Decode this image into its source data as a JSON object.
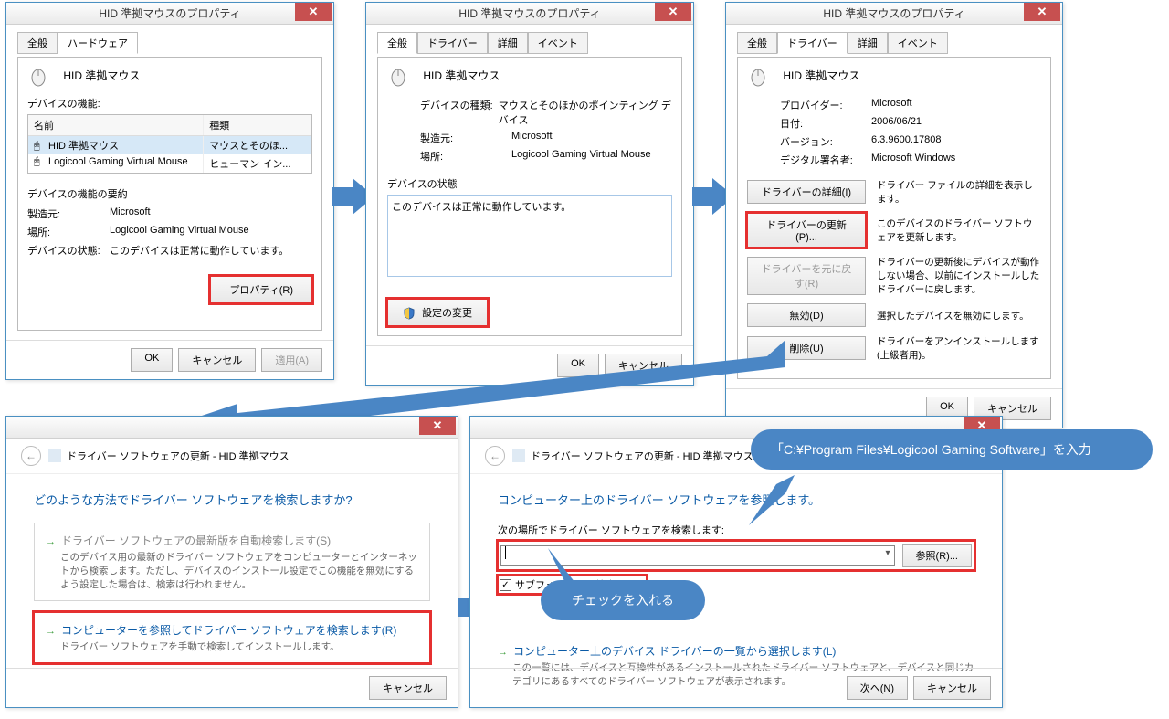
{
  "win1": {
    "title": "HID 準拠マウスのプロパティ",
    "tabs": [
      "全般",
      "ハードウェア"
    ],
    "device_name": "HID 準拠マウス",
    "func_label": "デバイスの機能:",
    "col_name": "名前",
    "col_type": "種類",
    "rows": [
      {
        "name": "HID 準拠マウス",
        "type": "マウスとそのほ..."
      },
      {
        "name": "Logicool Gaming Virtual Mouse",
        "type": "ヒューマン イン..."
      }
    ],
    "summary_label": "デバイスの機能の要約",
    "mfr_label": "製造元:",
    "mfr_val": "Microsoft",
    "loc_label": "場所:",
    "loc_val": "Logicool Gaming Virtual Mouse",
    "status_label": "デバイスの状態:",
    "status_val": "このデバイスは正常に動作しています。",
    "prop_btn": "プロパティ(R)",
    "ok": "OK",
    "cancel": "キャンセル",
    "apply": "適用(A)"
  },
  "win2": {
    "title": "HID 準拠マウスのプロパティ",
    "tabs": [
      "全般",
      "ドライバー",
      "詳細",
      "イベント"
    ],
    "device_name": "HID 準拠マウス",
    "type_label": "デバイスの種類:",
    "type_val": "マウスとそのほかのポインティング デバイス",
    "mfr_label": "製造元:",
    "mfr_val": "Microsoft",
    "loc_label": "場所:",
    "loc_val": "Logicool Gaming Virtual Mouse",
    "status_group": "デバイスの状態",
    "status_text": "このデバイスは正常に動作しています。",
    "change_btn": "設定の変更",
    "ok": "OK",
    "cancel": "キャンセル"
  },
  "win3": {
    "title": "HID 準拠マウスのプロパティ",
    "tabs": [
      "全般",
      "ドライバー",
      "詳細",
      "イベント"
    ],
    "device_name": "HID 準拠マウス",
    "prov_label": "プロバイダー:",
    "prov_val": "Microsoft",
    "date_label": "日付:",
    "date_val": "2006/06/21",
    "ver_label": "バージョン:",
    "ver_val": "6.3.9600.17808",
    "sig_label": "デジタル署名者:",
    "sig_val": "Microsoft Windows",
    "btn_detail": "ドライバーの詳細(I)",
    "desc_detail": "ドライバー ファイルの詳細を表示します。",
    "btn_update": "ドライバーの更新(P)...",
    "desc_update": "このデバイスのドライバー ソフトウェアを更新します。",
    "btn_rollback": "ドライバーを元に戻す(R)",
    "desc_rollback": "ドライバーの更新後にデバイスが動作しない場合、以前にインストールしたドライバーに戻します。",
    "btn_disable": "無効(D)",
    "desc_disable": "選択したデバイスを無効にします。",
    "btn_uninstall": "削除(U)",
    "desc_uninstall": "ドライバーをアンインストールします (上級者用)。",
    "ok": "OK",
    "cancel": "キャンセル"
  },
  "wiz1": {
    "header": "ドライバー ソフトウェアの更新 - HID 準拠マウス",
    "question": "どのような方法でドライバー ソフトウェアを検索しますか?",
    "opt1_title": "ドライバー ソフトウェアの最新版を自動検索します(S)",
    "opt1_desc": "このデバイス用の最新のドライバー ソフトウェアをコンピューターとインターネットから検索します。ただし、デバイスのインストール設定でこの機能を無効にするよう設定した場合は、検索は行われません。",
    "opt2_title": "コンピューターを参照してドライバー ソフトウェアを検索します(R)",
    "opt2_desc": "ドライバー ソフトウェアを手動で検索してインストールします。",
    "cancel": "キャンセル"
  },
  "wiz2": {
    "header": "ドライバー ソフトウェアの更新 - HID 準拠マウス",
    "heading": "コンピューター上のドライバー ソフトウェアを参照します。",
    "search_label": "次の場所でドライバー ソフトウェアを検索します:",
    "browse_btn": "参照(R)...",
    "subfolder": "サブフォルダーも検索する(I)",
    "pick_title": "コンピューター上のデバイス ドライバーの一覧から選択します(L)",
    "pick_desc": "この一覧には、デバイスと互換性があるインストールされたドライバー ソフトウェアと、デバイスと同じカテゴリにあるすべてのドライバー ソフトウェアが表示されます。",
    "next": "次へ(N)",
    "cancel": "キャンセル"
  },
  "callout1": "「C:¥Program Files¥Logicool Gaming Software」を入力",
  "callout2": "チェックを入れる"
}
